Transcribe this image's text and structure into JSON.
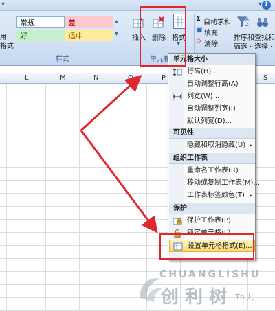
{
  "ribbon": {
    "cell_styles": {
      "normal": "常规",
      "bad": "差",
      "good": "好",
      "neutral": "适中"
    },
    "left_cut_labels": [
      "用",
      "格式",
      "·"
    ],
    "styles_group_label": "样式",
    "cells_group_label": "单元格",
    "insert_label": "插入",
    "delete_label": "删除",
    "format_label": "格式",
    "autosum_label": "自动求和",
    "fill_label": "填充",
    "clear_label": "清除",
    "sort_filter_label": "排序和\n筛选",
    "sort_filter_line1": "排序和",
    "sort_filter_line2": "筛选 ·",
    "find_select_line1": "查找和",
    "find_select_line2": "选择 ·",
    "help_glyph": "?"
  },
  "columns": [
    "L",
    "M",
    "N",
    "O",
    "P",
    "S"
  ],
  "menu": {
    "sections": [
      {
        "header": "单元格大小",
        "items": [
          "行高(H)...",
          "自动调整行高(A)",
          "列宽(W)...",
          "自动调整列宽(I)",
          "默认列宽(D)..."
        ]
      },
      {
        "header": "可见性",
        "items": [
          "隐藏和取消隐藏(U)"
        ]
      },
      {
        "header": "组织工作表",
        "items": [
          "重命名工作表(R)",
          "移动或复制工作表(M)...",
          "工作表标签颜色(T)"
        ]
      },
      {
        "header": "保护",
        "items": [
          "保护工作表(P)...",
          "锁定单元格(L)",
          "设置单元格格式(E)..."
        ]
      }
    ]
  },
  "watermark": {
    "letters": "CHUANGLISHU",
    "chinese": "创 利 树",
    "small": "Th 儿"
  },
  "colors": {
    "annotation_red": "#e0262e",
    "menu_highlight": "#ffd96b"
  }
}
